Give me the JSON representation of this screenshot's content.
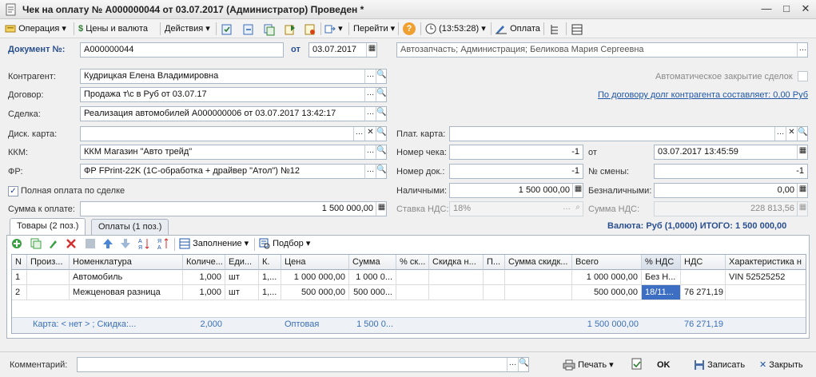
{
  "window": {
    "title": "Чек на оплату № А000000044 от 03.07.2017 (Администратор) Проведен *",
    "minimize": "—",
    "maximize": "□",
    "close": "✕"
  },
  "toolbar": {
    "operation": "Операция",
    "prices_currency": "Цены и валюта",
    "actions": "Действия",
    "go_to": "Перейти",
    "time": "(13:53:28)",
    "payment": "Оплата",
    "dropdown_glyph": "▾",
    "help_glyph": "?"
  },
  "header": {
    "doc_label": "Документ №:",
    "doc_number": "А000000044",
    "from_label": "от",
    "doc_date": "03.07.2017",
    "org_info": "Автозапчасть; Администрация; Беликова Мария Сергеевна"
  },
  "left_fields": {
    "counterparty_label": "Контрагент:",
    "counterparty": "Кудрицкая Елена Владимировна",
    "contract_label": "Договор:",
    "contract": "Продажа т\\с в Руб от 03.07.17",
    "deal_label": "Сделка:",
    "deal": "Реализация автомобилей А000000006 от 03.07.2017 13:42:17",
    "disc_card_label": "Диск. карта:",
    "disc_card": "",
    "kkm_label": "ККМ:",
    "kkm": "ККМ Магазин \"Авто трейд\"",
    "fr_label": "ФР:",
    "fr": "ФР FPrint-22K (1С-обработка + драйвер \"Атол\") №12",
    "full_payment_label": "Полная оплата по сделке",
    "full_payment_checked": "✓",
    "sum_label": "Сумма к оплате:",
    "sum": "1 500 000,00"
  },
  "right_fields": {
    "auto_close_label": "Автоматическое закрытие сделок",
    "debt_link": "По договору долг контрагента составляет: 0,00 Руб",
    "pay_card_label": "Плат. карта:",
    "pay_card": "",
    "check_no_label": "Номер чека:",
    "check_no": "-1",
    "check_from_label": "от",
    "check_date": "03.07.2017 13:45:59",
    "doc_no_label": "Номер док.:",
    "doc_no": "-1",
    "shift_label": "№ смены:",
    "shift": "-1",
    "cash_label": "Наличными:",
    "cash": "1 500 000,00",
    "noncash_label": "Безналичными:",
    "noncash": "0,00",
    "vat_rate_label": "Ставка НДС:",
    "vat_rate": "18%",
    "vat_sum_label": "Сумма НДС:",
    "vat_sum": "228 813,56",
    "currency_total": "Валюта: Руб (1,0000) ИТОГО: 1 500 000,00"
  },
  "tabs": [
    {
      "label": "Товары (2 поз.)"
    },
    {
      "label": "Оплаты (1 поз.)"
    }
  ],
  "table_toolbar": {
    "fill": "Заполнение",
    "selection": "Подбор"
  },
  "table": {
    "columns": [
      "N",
      "Произ...",
      "Номенклатура",
      "Количе...",
      "Еди...",
      "К.",
      "Цена",
      "Сумма",
      "% ск...",
      "Скидка н...",
      "П...",
      "Сумма скидк...",
      "Всего",
      "% НДС",
      "НДС",
      "Характеристика н"
    ],
    "rows": [
      [
        "1",
        "",
        "Автомобиль",
        "1,000",
        "шт",
        "1,...",
        "1 000 000,00",
        "1 000 0...",
        "",
        "",
        "",
        "",
        "1 000 000,00",
        "Без Н...",
        "",
        "VIN 52525252"
      ],
      [
        "2",
        "",
        "Межценовая разница",
        "1,000",
        "шт",
        "1,...",
        "500 000,00",
        "500 000...",
        "",
        "",
        "",
        "",
        "500 000,00",
        "18/11...",
        "76 271,19",
        ""
      ]
    ],
    "footer": {
      "card": "Карта: < нет > ; Скидка:...",
      "qty": "2,000",
      "price_type": "Оптовая",
      "sum": "1 500 0...",
      "total": "1 500 000,00",
      "vat": "76 271,19"
    }
  },
  "bottom": {
    "comment_label": "Комментарий:",
    "comment": "",
    "print": "Печать",
    "ok": "OK",
    "save": "Записать",
    "close": "Закрыть"
  },
  "colors": {
    "accent_blue": "#2a4f8f",
    "link_blue": "#1f56a8",
    "selection": "#3c6fc4"
  }
}
